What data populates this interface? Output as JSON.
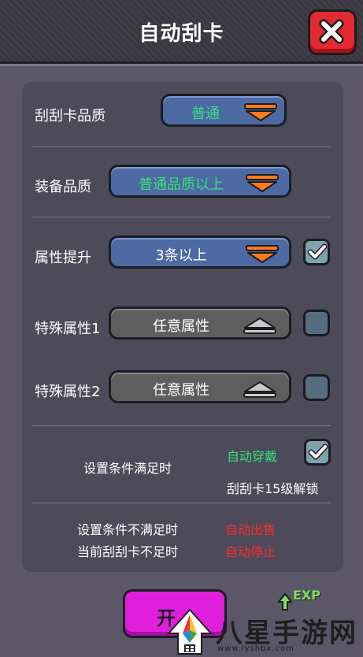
{
  "dialog": {
    "title": "自动刮卡",
    "close_icon": "close-x-icon"
  },
  "rows": {
    "card_quality": {
      "label": "刮刮卡品质",
      "value": "普通"
    },
    "equip_quality": {
      "label": "装备品质",
      "value": "普通品质以上"
    },
    "attr_upgrade": {
      "label": "属性提升",
      "value": "3条以上",
      "checked": true
    },
    "special_attr_1": {
      "label": "特殊属性1",
      "value": "任意属性",
      "checked": false
    },
    "special_attr_2": {
      "label": "特殊属性2",
      "value": "任意属性",
      "checked": false
    }
  },
  "condition_met": {
    "label": "设置条件满足时",
    "option": "自动穿戴",
    "checked": true,
    "note": "刮刮卡15级解锁"
  },
  "condition_unmet": {
    "label": "设置条件不满足时",
    "action": "自动出售"
  },
  "card_insufficient": {
    "label": "当前刮刮卡不足时",
    "action": "自动停止"
  },
  "start_button": {
    "label": "开"
  },
  "exp_badge": {
    "label": "EXP"
  },
  "watermark": {
    "text": "八星手游网",
    "url": "www.lyshbx.com"
  },
  "colors": {
    "green_text": "#33e07a",
    "red_text": "#ff2b2b",
    "dropdown_blue": "#4d6aa3",
    "dropdown_gray": "#5e5e5e",
    "arrow_orange": "#ff7a1a",
    "start_magenta": "#e01fdc",
    "close_red": "#e22a31"
  }
}
